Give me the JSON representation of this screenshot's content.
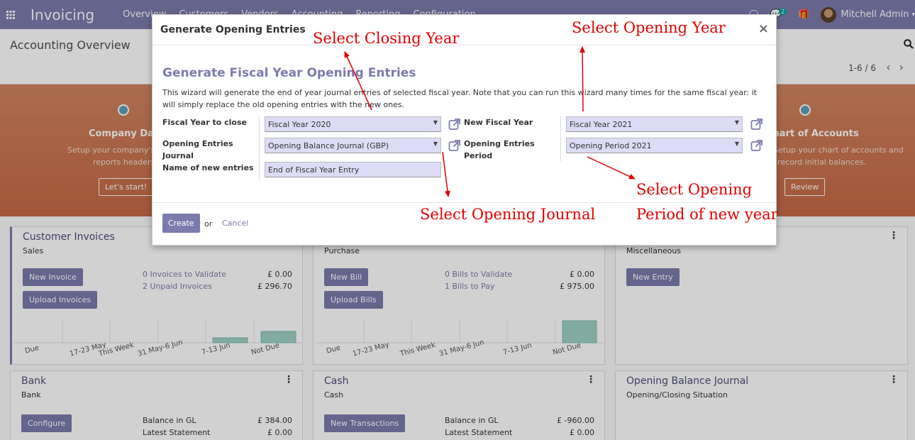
{
  "navbar": {
    "app_name": "Invoicing",
    "menu": [
      "Overview",
      "Customers",
      "Vendors",
      "Accounting",
      "Reporting",
      "Configuration"
    ],
    "chat_badge": "2",
    "user_name": "Mitchell Admin",
    "color": "#7c7bad"
  },
  "control": {
    "breadcrumb": "Accounting Overview",
    "pager": "1-6 / 6"
  },
  "banner": {
    "left_title": "Company Data",
    "left_desc_1": "Setup your company's",
    "left_desc_2": "reports headers",
    "left_button": "Let's start!",
    "right_title": "Chart of Accounts",
    "right_desc_1": "Setup your chart of accounts and",
    "right_desc_2": "record initial balances.",
    "right_button": "Review"
  },
  "cards": {
    "customer_invoices": {
      "title": "Customer Invoices",
      "subtitle": "Sales",
      "btn1": "New Invoice",
      "btn2": "Upload Invoices",
      "stat1_label": "0 Invoices to Validate",
      "stat1_value": "£ 0.00",
      "stat2_label": "2 Unpaid Invoices",
      "stat2_value": "£ 296.70",
      "ticks": [
        "Due",
        "17-23 May",
        "This Week",
        "31 May-6 Jun",
        "7-13 Jun",
        "Not Due"
      ]
    },
    "vendor_bills": {
      "subtitle": "Purchase",
      "btn1": "New Bill",
      "btn2": "Upload Bills",
      "stat1_label": "0 Bills to Validate",
      "stat1_value": "£ 0.00",
      "stat2_label": "1 Bills to Pay",
      "stat2_value": "£ 975.00",
      "ticks": [
        "Due",
        "17-23 May",
        "This Week",
        "31 May-6 Jun",
        "7-13 Jun",
        "Not Due"
      ]
    },
    "misc": {
      "subtitle": "Miscellaneous",
      "btn1": "New Entry"
    },
    "bank": {
      "title": "Bank",
      "subtitle": "Bank",
      "btn1": "Configure",
      "stat1_label": "Balance in GL",
      "stat1_value": "£ 384.00",
      "stat2_label": "Latest Statement",
      "stat2_value": "£ 0.00"
    },
    "cash": {
      "title": "Cash",
      "subtitle": "Cash",
      "btn1": "New Transactions",
      "stat1_label": "Balance in GL",
      "stat1_value": "£ -960.00",
      "stat2_label": "Latest Statement",
      "stat2_value": "£ 0.00"
    },
    "opening": {
      "title": "Opening Balance Journal",
      "subtitle": "Opening/Closing Situation"
    }
  },
  "modal": {
    "title": "Generate Opening Entries",
    "close": "×",
    "section_title": "Generate Fiscal Year Opening Entries",
    "description": "This wizard will generate the end of year journal entries of selected fiscal year. Note that you can run this wizard many times for the same fiscal year: it will simply replace the old opening entries with the new ones.",
    "fields": {
      "fy_close_label": "Fiscal Year to close",
      "fy_close_value": "Fiscal Year 2020",
      "journal_label_1": "Opening Entries",
      "journal_label_2": "Journal",
      "journal_value": "Opening Balance Journal (GBP)",
      "name_label": "Name of new entries",
      "name_value": "End of Fiscal Year Entry",
      "new_fy_label": "New Fiscal Year",
      "new_fy_value": "Fiscal Year 2021",
      "period_label_1": "Opening Entries",
      "period_label_2": "Period",
      "period_value": "Opening Period 2021"
    },
    "create_button": "Create",
    "or": "or",
    "cancel": "Cancel"
  },
  "annotations": {
    "closing_year": "Select Closing Year",
    "opening_year": "Select Opening Year",
    "opening_journal": "Select Opening Journal",
    "opening_period_1": "Select Opening",
    "opening_period_2": "Period of new year",
    "color": "#e00000"
  }
}
